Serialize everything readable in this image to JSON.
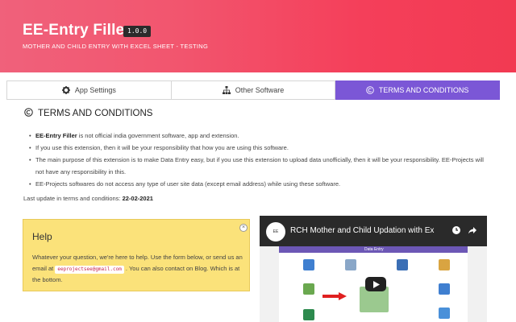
{
  "header": {
    "title": "EE-Entry Filler",
    "version": "1.0.0",
    "subtitle": "MOTHER AND CHILD ENTRY WITH EXCEL SHEET - TESTING",
    "gradient_colors": [
      "#f0617b",
      "#f23a52"
    ]
  },
  "tabs": [
    {
      "label": "App Settings",
      "icon": "gear-icon",
      "active": false
    },
    {
      "label": "Other Software",
      "icon": "sitemap-icon",
      "active": false
    },
    {
      "label": "TERMS AND CONDITIONS",
      "icon": "copyright-icon",
      "active": true
    }
  ],
  "accent_color": "#7b57d6",
  "terms": {
    "heading": "TERMS AND CONDITIONS",
    "items": [
      {
        "bold": "EE-Entry Filler",
        "text": " is not official india government software, app and extension."
      },
      {
        "bold": "",
        "text": "If you use this extension, then it will be your responsibility that how you are using this software."
      },
      {
        "bold": "",
        "text": "The main purpose of this extension is to make Data Entry easy, but if you use this extension to upload data unofficially, then it will be your responsibility. EE-Projects will not have any responsibility in this."
      },
      {
        "bold": "",
        "text": "EE-Projects softwares do not access any type of user site data (except email address) while using these software."
      }
    ],
    "last_update_label": "Last update in terms and conditions: ",
    "last_update_date": "22-02-2021"
  },
  "help": {
    "title": "Help",
    "text_before": "Whatever your question, we're here to help. Use the form below, or send us an email at ",
    "email": "eeprojectsee@gmail.com",
    "text_after": " . You can also contact on Blog. Which is at the bottom.",
    "close_symbol": "×",
    "background": "#fbe27a"
  },
  "video": {
    "title": "RCH Mother and Child Updation with Ex",
    "channel": "EE",
    "site_bar_label": "Data Entry",
    "play_icon": "play-icon"
  }
}
